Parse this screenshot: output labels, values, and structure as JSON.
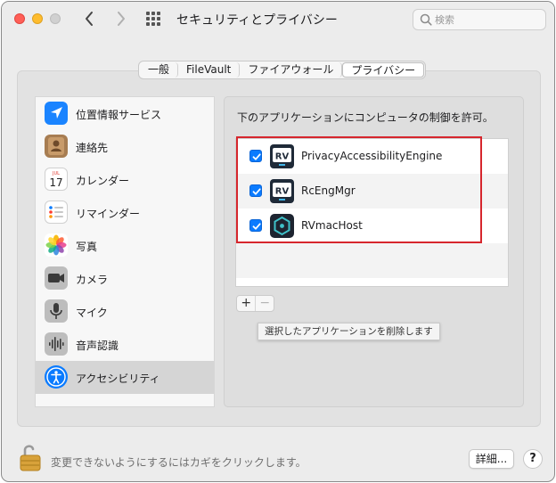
{
  "window": {
    "title": "セキュリティとプライバシー",
    "search_placeholder": "検索",
    "icons": {
      "back": "chevron-left-icon",
      "forward": "chevron-right-icon",
      "grid": "grid-icon",
      "search": "search-icon"
    }
  },
  "tabs": [
    {
      "label": "一般",
      "active": false
    },
    {
      "label": "FileVault",
      "active": false
    },
    {
      "label": "ファイアウォール",
      "active": false
    },
    {
      "label": "プライバシー",
      "active": true
    }
  ],
  "sidebar": {
    "items": [
      {
        "label": "位置情報サービス",
        "icon": "location-arrow-icon",
        "color": "#1a84ff"
      },
      {
        "label": "連絡先",
        "icon": "contacts-icon",
        "color": "#a77d52"
      },
      {
        "label": "カレンダー",
        "icon": "calendar-icon",
        "month": "JUL",
        "day": "17"
      },
      {
        "label": "リマインダー",
        "icon": "reminders-icon"
      },
      {
        "label": "写真",
        "icon": "photos-icon"
      },
      {
        "label": "カメラ",
        "icon": "camera-icon"
      },
      {
        "label": "マイク",
        "icon": "microphone-icon"
      },
      {
        "label": "音声認識",
        "icon": "speech-recognition-icon"
      },
      {
        "label": "アクセシビリティ",
        "icon": "accessibility-icon",
        "color": "#0a7bff",
        "selected": true
      }
    ]
  },
  "main": {
    "description": "下のアプリケーションにコンピュータの制御を許可。",
    "apps": [
      {
        "name": "PrivacyAccessibilityEngine",
        "checked": true,
        "icon": "rv-icon",
        "icon_text": "RV"
      },
      {
        "name": "RcEngMgr",
        "checked": true,
        "icon": "rv-icon",
        "icon_text": "RV"
      },
      {
        "name": "RVmacHost",
        "checked": true,
        "icon": "rvmachost-icon"
      }
    ],
    "add_label": "+",
    "remove_label": "−",
    "tooltip": "選択したアプリケーションを削除します"
  },
  "footer": {
    "lock_text": "変更できないようにするにはカギをクリックします。",
    "details_label": "詳細...",
    "help_label": "?"
  },
  "colors": {
    "accent": "#0a7bff",
    "highlight": "#d6262d"
  }
}
